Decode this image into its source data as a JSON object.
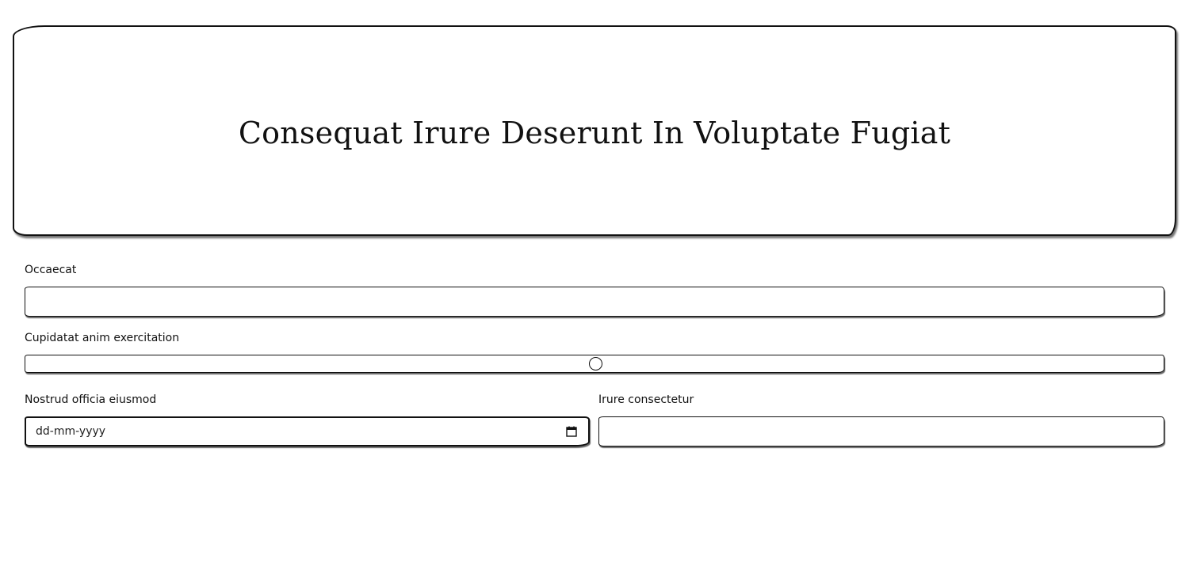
{
  "hero": {
    "title": "Consequat Irure Deserunt In Voluptate Fugiat"
  },
  "form": {
    "occaecat": {
      "label": "Occaecat",
      "value": "",
      "placeholder": ""
    },
    "cupidatat": {
      "label": "Cupidatat anim exercitation",
      "value": 0.5
    },
    "nostrud": {
      "label": "Nostrud officia eiusmod",
      "placeholder": "dd-mm-yyyy",
      "icon": "calendar-icon"
    },
    "irure": {
      "label": "Irure consectetur",
      "value": "",
      "placeholder": ""
    }
  },
  "colors": {
    "ink": "#111111",
    "background": "#ffffff"
  }
}
